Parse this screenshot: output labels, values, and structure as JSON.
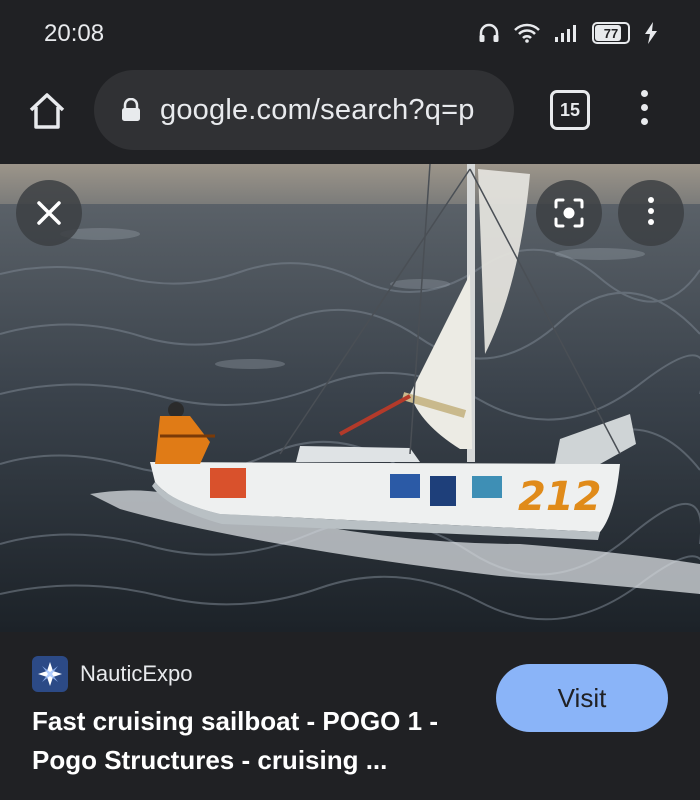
{
  "status_bar": {
    "time": "20:08",
    "battery_level": "77",
    "charging": true,
    "icons": [
      "headphones-icon",
      "wifi-icon",
      "signal-icon",
      "battery-icon",
      "charging-bolt-icon"
    ]
  },
  "toolbar": {
    "url": "google.com/search?q=p",
    "tab_count": "15",
    "icons": [
      "home-icon",
      "lock-icon",
      "tabs-icon",
      "overflow-menu-icon"
    ]
  },
  "image_viewer": {
    "buttons": [
      "close-icon",
      "lens-icon",
      "more-options-icon"
    ],
    "hull_number": "212"
  },
  "result": {
    "source_name": "NauticExpo",
    "title": "Fast cruising sailboat - POGO 1 - Pogo Structures - cruising ...",
    "visit_label": "Visit"
  },
  "colors": {
    "background": "#202124",
    "omnibox": "#303134",
    "visit_button": "#8ab4f8"
  }
}
